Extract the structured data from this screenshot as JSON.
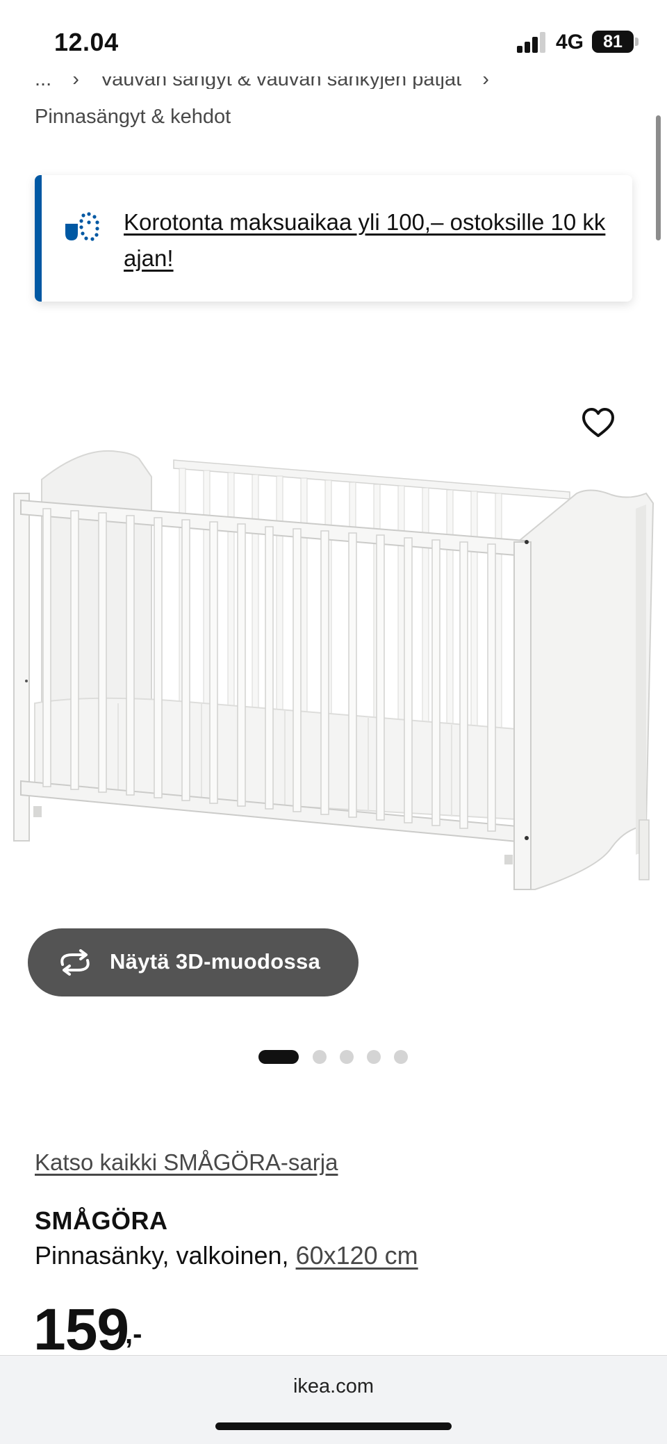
{
  "status_bar": {
    "time": "12.04",
    "network": "4G",
    "battery": "81"
  },
  "breadcrumb": {
    "ellipsis": "...",
    "hidden_item": "Vauvan sängyt & vauvan sänkyjen patjat",
    "current": "Pinnasängyt & kehdot"
  },
  "promo": {
    "icon": "payment-icon",
    "text": "Korotonta maksuaikaa yli 100,– ostoksille 10 kk ajan!",
    "accent_color": "#0058a3"
  },
  "gallery": {
    "wishlist_icon": "heart-icon",
    "view_3d_label": "Näytä 3D-muodossa",
    "view_3d_icon": "rotate-icon",
    "image_count": 5,
    "active_index": 0
  },
  "product": {
    "series_link": "Katso kaikki SMÅGÖRA-sarja",
    "name": "SMÅGÖRA",
    "description": "Pinnasänky, valkoinen, ",
    "size": "60x120 cm",
    "price": "159",
    "price_suffix": ",-"
  },
  "browser": {
    "url": "ikea.com"
  }
}
